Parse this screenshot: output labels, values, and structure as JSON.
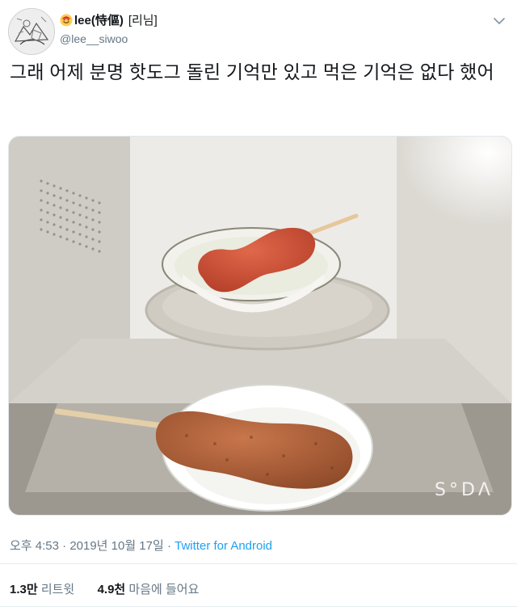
{
  "author": {
    "display_name": "lee(恃傴)",
    "name_extra": "[리님]",
    "handle": "@lee__siwoo",
    "emoji_icon": "smiling-face-icon"
  },
  "tweet": {
    "text": "그래 어제 분명 핫도그 돌린 기억만 있고 먹은 기억은 없다 했어"
  },
  "media": {
    "watermark": "S°DΛ"
  },
  "meta": {
    "time": "오후 4:53",
    "date": "2019년 10월 17일",
    "separator": "·",
    "source": "Twitter for Android"
  },
  "stats": {
    "retweets_count": "1.3만",
    "retweets_label": "리트윗",
    "likes_count": "4.9천",
    "likes_label": "마음에 들어요"
  },
  "colors": {
    "link": "#1da1f2",
    "secondary": "#657786",
    "text": "#14171a"
  }
}
